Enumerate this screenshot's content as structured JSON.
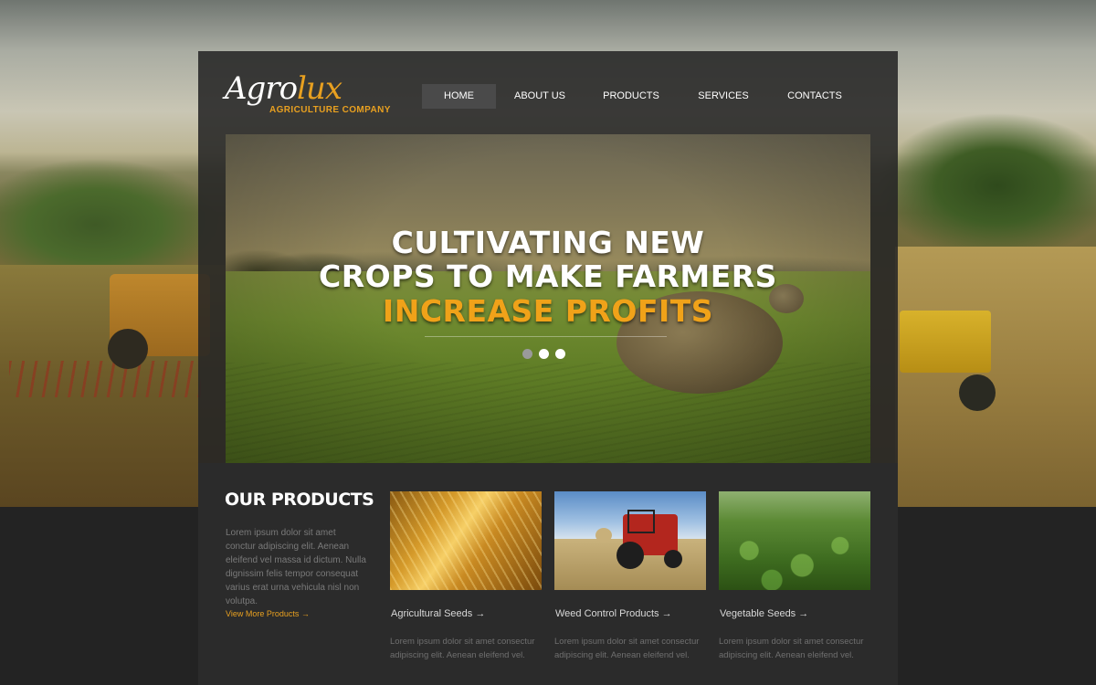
{
  "logo": {
    "main_plain": "Agro",
    "main_accent": "lux",
    "tagline": "AGRICULTURE COMPANY"
  },
  "nav": {
    "home": "HOME",
    "about": "ABOUT US",
    "products": "PRODUCTS",
    "services": "SERVICES",
    "contacts": "CONTACTS",
    "active": "HOME"
  },
  "hero": {
    "line1": "CULTIVATING NEW",
    "line2": "CROPS TO MAKE FARMERS",
    "line3": "INCREASE PROFITS",
    "slides_total": 3,
    "slide_active": 3
  },
  "products_section": {
    "title": "OUR PRODUCTS",
    "text": "Lorem ipsum dolor sit amet conctur adipiscing elit. Aenean eleifend vel massa id dictum. Nulla dignissim felis tempor consequat varius erat urna vehicula nisl non volutpa.",
    "view_more": "View More Products  →"
  },
  "products": [
    {
      "title": "Agricultural Seeds  →",
      "desc": "Lorem ipsum dolor sit amet consectur adipiscing elit. Aenean eleifend vel."
    },
    {
      "title": "Weed Control Products  →",
      "desc": "Lorem ipsum dolor sit amet consectur adipiscing elit. Aenean eleifend vel."
    },
    {
      "title": "Vegetable Seeds  →",
      "desc": "Lorem ipsum dolor sit amet consectur adipiscing elit. Aenean eleifend vel."
    }
  ],
  "colors": {
    "accent": "#e8a020",
    "panel": "#262626",
    "nav_active_bg": "#4a4a4a"
  }
}
